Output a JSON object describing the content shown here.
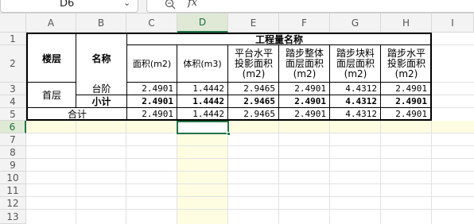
{
  "name_box": {
    "value": "D6"
  },
  "formula_bar": {
    "fx_label": "fx",
    "value": ""
  },
  "columns": [
    "A",
    "B",
    "C",
    "D",
    "E",
    "F",
    "G",
    "H",
    "I"
  ],
  "rows": [
    "1",
    "2",
    "3",
    "4",
    "5",
    "6",
    "7",
    "8",
    "9",
    "10",
    "11",
    "12",
    "13"
  ],
  "sheet": {
    "header_top": "工程量名称",
    "floor_label": "楼层",
    "name_label": "名称",
    "col_headers": [
      "面积(m2)",
      "体积(m3)",
      "平台水平投影面积(m2)",
      "踏步整体面层面积(m2)",
      "踏步块料面层面积(m2)",
      "踏步水平投影面积(m2)"
    ],
    "floor_value": "首层",
    "row3": {
      "name": "台阶",
      "values": [
        "2.4901",
        "1.4442",
        "2.9465",
        "2.4901",
        "4.4312",
        "2.4901"
      ]
    },
    "row4": {
      "name": "小计",
      "values": [
        "2.4901",
        "1.4442",
        "2.9465",
        "2.4901",
        "4.4312",
        "2.4901"
      ]
    },
    "row5": {
      "name": "合计",
      "values": [
        "2.4901",
        "1.4442",
        "2.9465",
        "2.4901",
        "4.4312",
        "2.4901"
      ]
    }
  },
  "colors": {
    "accent": "#217346",
    "selected_row": "#fefde2",
    "header_bg": "#f3f3f3"
  }
}
